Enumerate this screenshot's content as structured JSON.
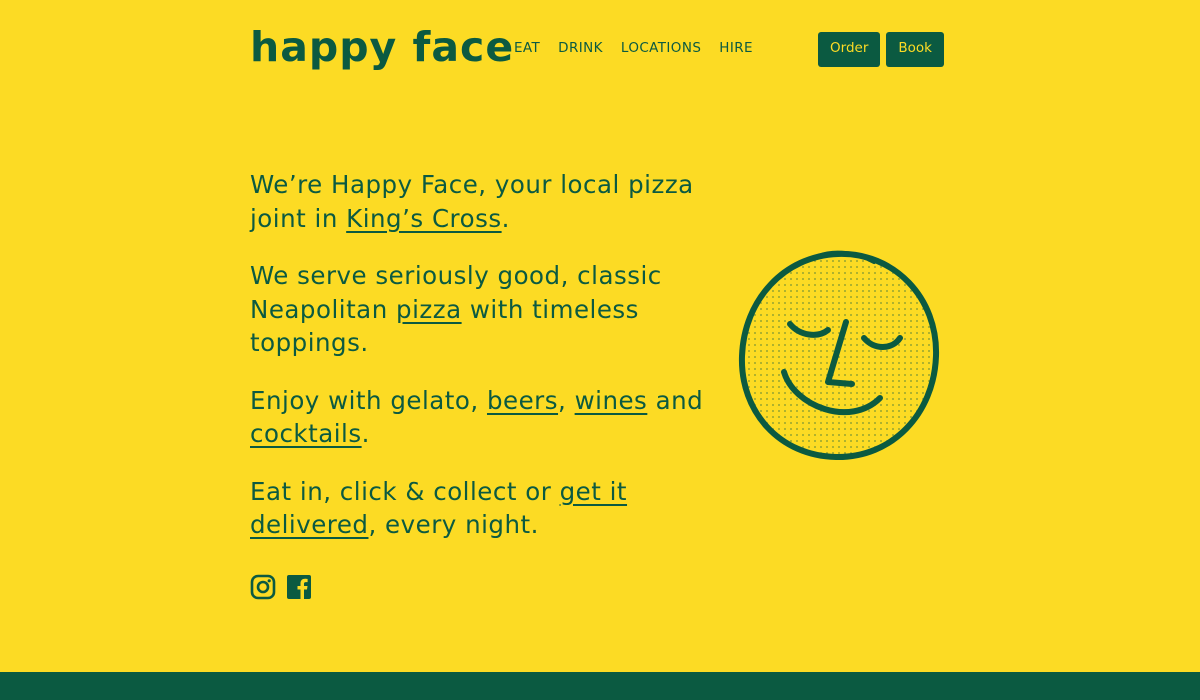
{
  "brand": {
    "logo": "happy face"
  },
  "nav": {
    "items": [
      "EAT",
      "DRINK",
      "LOCATIONS",
      "HIRE"
    ]
  },
  "buttons": {
    "order": "Order",
    "book": "Book"
  },
  "intro": {
    "p1_a": "We’re Happy Face, your local pizza joint in ",
    "p1_link": "King’s Cross",
    "p1_b": ".",
    "p2_a": "We serve seriously good, classic Neapolitan ",
    "p2_link": "pizza",
    "p2_b": " with timeless toppings.",
    "p3_a": "Enjoy with gelato, ",
    "p3_link1": "beers",
    "p3_sep": ", ",
    "p3_link2": "wines",
    "p3_b": " and ",
    "p3_link3": "cocktails",
    "p3_c": ".",
    "p4_a": "Eat in, click ",
    "p4_amp": "&",
    "p4_b": " collect or ",
    "p4_link": "get it delivered",
    "p4_c": ", every night."
  },
  "social": {
    "icons": [
      "instagram-icon",
      "facebook-icon"
    ]
  },
  "colors": {
    "background": "#fcdb24",
    "brand_green": "#0b5a41"
  }
}
